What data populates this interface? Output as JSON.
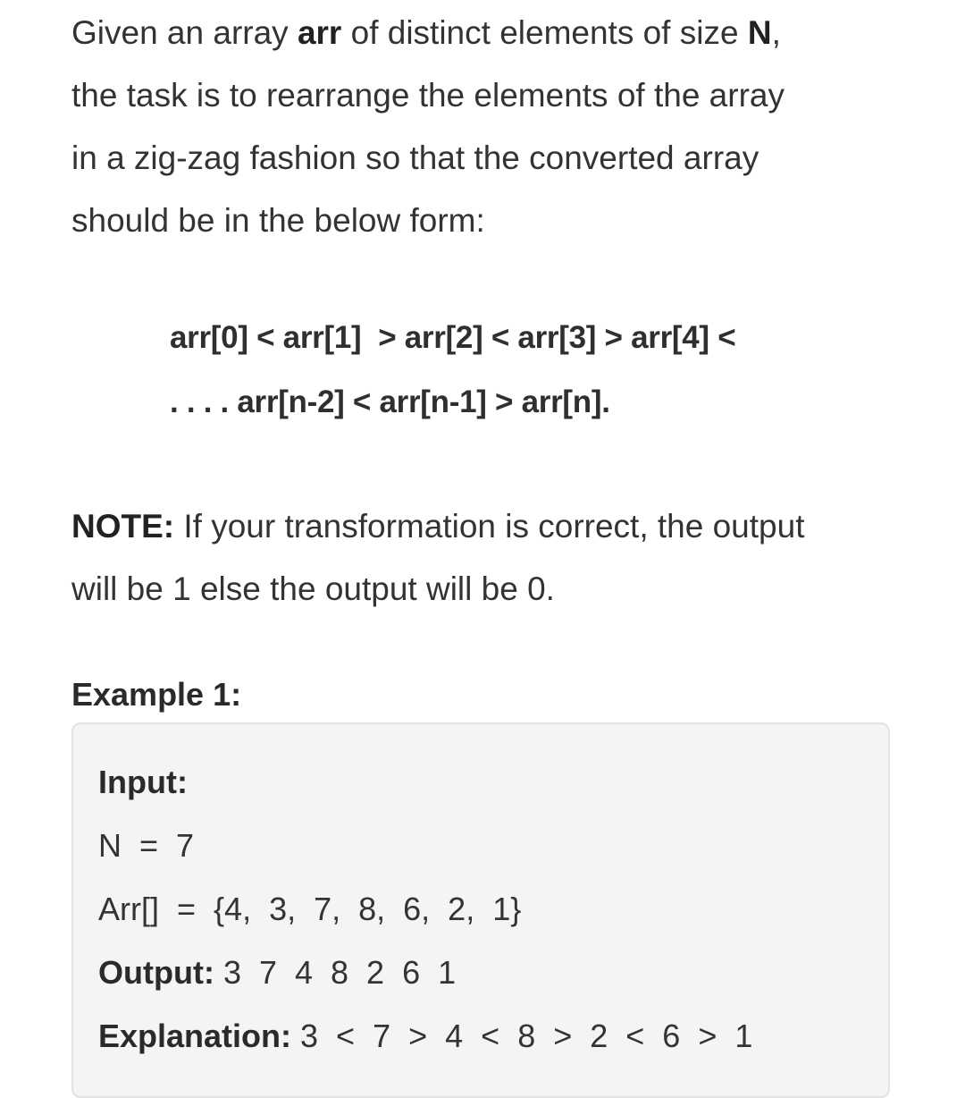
{
  "intro": {
    "line1_pre": "Given an array ",
    "line1_arr": "arr",
    "line1_mid": " of distinct elements of size ",
    "line1_n": "N",
    "line1_post": ",",
    "line2": "the task is to rearrange the elements of the array",
    "line3": "in a zig-zag fashion so that the converted array",
    "line4": "should be in the below form:"
  },
  "formula": {
    "line1": "arr[0] < arr[1]  > arr[2] < arr[3] > arr[4] <",
    "line2": ". . . . arr[n-2] < arr[n-1] > arr[n]."
  },
  "note": {
    "label": "NOTE:",
    "line1": " If your transformation is correct, the output",
    "line2": "will be 1 else the output will be 0."
  },
  "example": {
    "heading": "Example 1:",
    "input_label": "Input:",
    "n_line": "N  =  7",
    "arr_line": "Arr[]  =  {4,  3,  7,  8,  6,  2,  1}",
    "output_label": "Output:",
    "output_value": " 3  7  4  8  2  6  1",
    "explanation_label": "Explanation:",
    "explanation_value": " 3  <  7  >  4  <  8  >  2  <  6  >  1"
  }
}
